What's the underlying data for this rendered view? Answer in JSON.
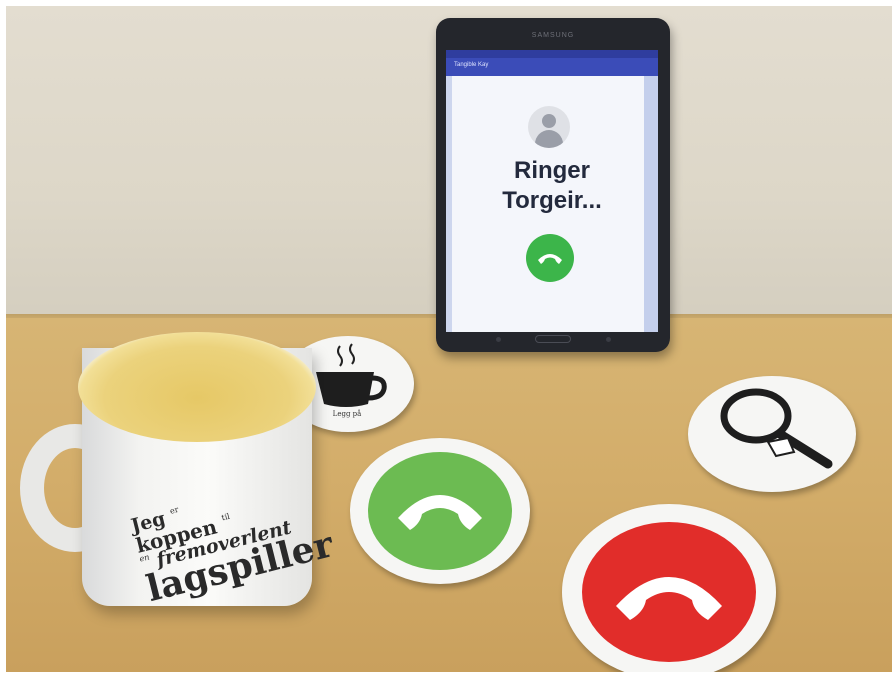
{
  "tablet": {
    "brand": "SAMSUNG",
    "app_title": "Tangible Kay",
    "calling_line1": "Ringer",
    "calling_line2": "Torgeir...",
    "call_button_color": "#3cb54a"
  },
  "mug": {
    "line1": "Jeg",
    "line1_small": "er",
    "line2": "koppen",
    "line2_small": "til",
    "line3_prefix": "en",
    "line3": "fremoverlent",
    "line4": "lagspiller"
  },
  "coasters": {
    "cup_label": "Legg på",
    "green_color": "#6cbb52",
    "red_color": "#e12d2a",
    "icons": [
      "coffee-cup-icon",
      "phone-answer-icon",
      "magnifier-icon",
      "phone-hangup-icon"
    ]
  }
}
